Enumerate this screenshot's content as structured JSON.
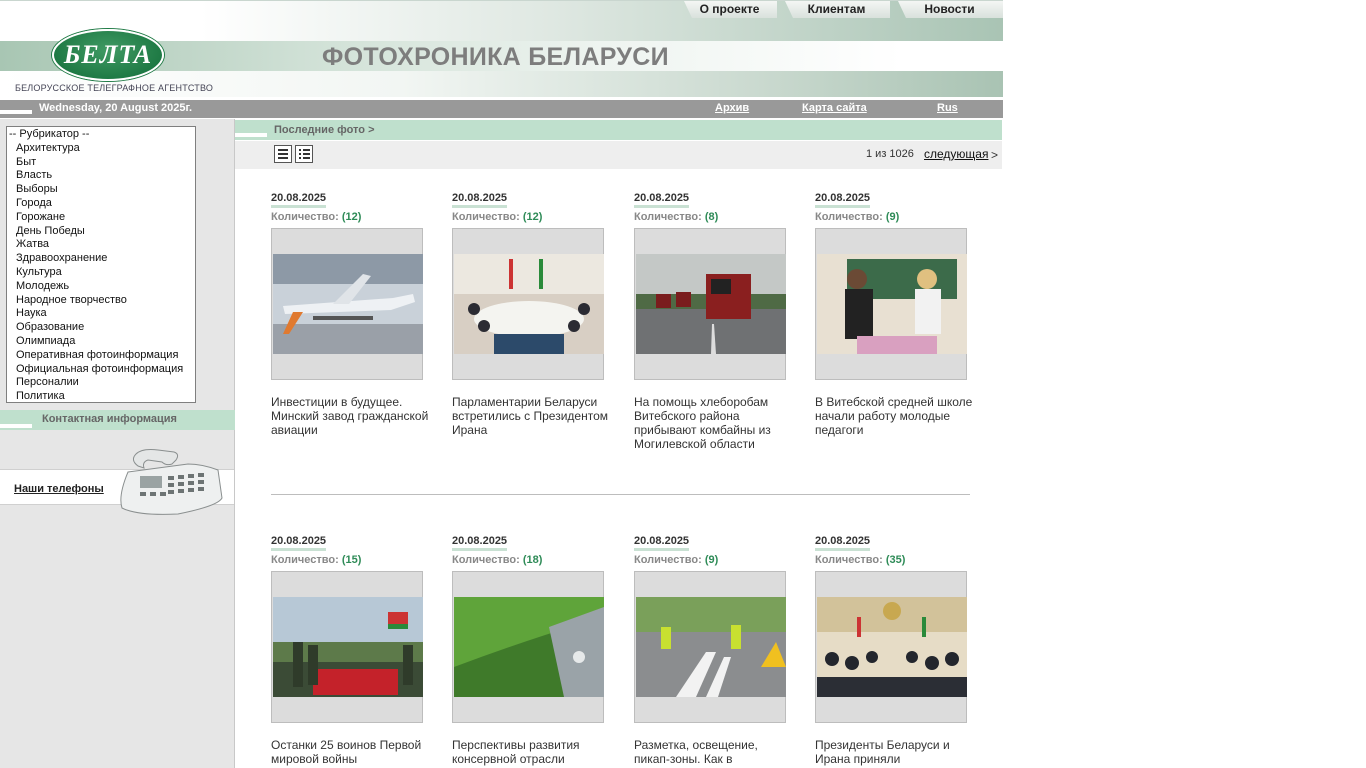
{
  "header": {
    "top_nav": [
      "О проекте",
      "Клиентам",
      "Новости"
    ],
    "logo_text": "БЕЛТА",
    "agency_name": "БЕЛОРУССКОЕ ТЕЛЕГРАФНОЕ АГЕНТСТВО",
    "site_title": "ФОТОХРОНИКА БЕЛАРУСИ"
  },
  "datebar": {
    "date": "Wednesday, 20 August 2025г.",
    "archive": "Архив",
    "sitemap": "Карта сайта",
    "lang": "Rus"
  },
  "sidebar": {
    "rubricator": [
      "-- Рубрикатор --",
      "Архитектура",
      "Быт",
      "Власть",
      "Выборы",
      "Города",
      "Горожане",
      "День Победы",
      "Жатва",
      "Здравоохранение",
      "Культура",
      "Молодежь",
      "Народное творчество",
      "Наука",
      "Образование",
      "Олимпиада",
      "Оперативная фотоинформация",
      "Официальная фотоинформация",
      "Персоналии",
      "Политика"
    ],
    "contact_heading": "Контактная информация",
    "phones_link": "Наши телефоны"
  },
  "main": {
    "section_title": "Последние фото >",
    "pager": {
      "status": "1 из 1026",
      "next": "следующая",
      "arrow": ">"
    },
    "count_label": "Количество:",
    "cards": [
      {
        "date": "20.08.2025",
        "count": "(12)",
        "title": "Инвестиции в будущее. Минский завод гражданской авиации"
      },
      {
        "date": "20.08.2025",
        "count": "(12)",
        "title": "Парламентарии Беларуси встретились с Президентом Ирана"
      },
      {
        "date": "20.08.2025",
        "count": "(8)",
        "title": "На помощь хлеборобам Витебского района прибывают комбайны из Могилевской области"
      },
      {
        "date": "20.08.2025",
        "count": "(9)",
        "title": "В Витебской средней школе начали работу молодые педагоги"
      },
      {
        "date": "20.08.2025",
        "count": "(15)",
        "title": "Останки 25 воинов Первой мировой войны"
      },
      {
        "date": "20.08.2025",
        "count": "(18)",
        "title": "Перспективы развития консервной отрасли"
      },
      {
        "date": "20.08.2025",
        "count": "(9)",
        "title": "Разметка, освещение, пикап-зоны. Как в"
      },
      {
        "date": "20.08.2025",
        "count": "(35)",
        "title": "Президенты Беларуси и Ирана приняли"
      }
    ]
  }
}
